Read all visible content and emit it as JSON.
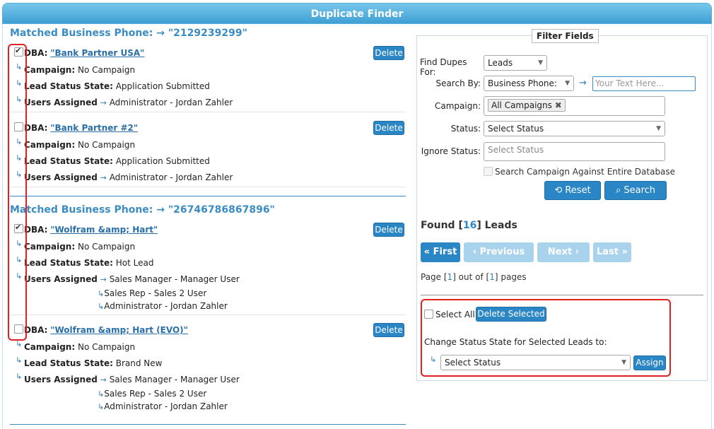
{
  "window": {
    "title": "Duplicate Finder"
  },
  "groups": [
    {
      "heading_label": "Matched Business Phone: → ",
      "heading_value": "\"2129239299\"",
      "records": [
        {
          "checked": true,
          "dba_label": "DBA:",
          "dba_value": "\"Bank Partner USA\"",
          "campaign_label": "Campaign:",
          "campaign_value": "No Campaign",
          "status_label": "Lead Status State:",
          "status_value": "Application Submitted",
          "users_label": "Users Assigned",
          "users": [
            "Administrator - Jordan Zahler"
          ],
          "delete_label": "Delete"
        },
        {
          "checked": false,
          "dba_label": "DBA:",
          "dba_value": "\"Bank Partner #2\"",
          "campaign_label": "Campaign:",
          "campaign_value": "No Campaign",
          "status_label": "Lead Status State:",
          "status_value": "Application Submitted",
          "users_label": "Users Assigned",
          "users": [
            "Administrator - Jordan Zahler"
          ],
          "delete_label": "Delete"
        }
      ]
    },
    {
      "heading_label": "Matched Business Phone: → ",
      "heading_value": "\"26746786867896\"",
      "records": [
        {
          "checked": true,
          "dba_label": "DBA:",
          "dba_value": "\"Wolfram &amp; Hart\"",
          "campaign_label": "Campaign:",
          "campaign_value": "No Campaign",
          "status_label": "Lead Status State:",
          "status_value": "Hot Lead",
          "users_label": "Users Assigned",
          "users": [
            "Sales Manager - Manager User",
            "Sales Rep - Sales 2 User",
            "Administrator - Jordan Zahler"
          ],
          "delete_label": "Delete"
        },
        {
          "checked": false,
          "dba_label": "DBA:",
          "dba_value": "\"Wolfram &amp; Hart (EVO)\"",
          "campaign_label": "Campaign:",
          "campaign_value": "No Campaign",
          "status_label": "Lead Status State:",
          "status_value": "Brand New",
          "users_label": "Users Assigned",
          "users": [
            "Sales Manager - Manager User",
            "Sales Rep - Sales 2 User",
            "Administrator - Jordan Zahler"
          ],
          "delete_label": "Delete"
        }
      ]
    }
  ],
  "filter": {
    "legend": "Filter Fields",
    "find_dupes_label": "Find Dupes For:",
    "find_dupes_value": "Leads",
    "search_by_label": "Search By:",
    "search_by_value": "Business Phone:",
    "search_placeholder": "Your Text Here...",
    "campaign_label": "Campaign:",
    "campaign_chip": "All Campaigns",
    "status_label": "Status:",
    "status_value": "Select Status",
    "ignore_status_label": "Ignore Status:",
    "ignore_status_placeholder": "Select Status",
    "search_entire_label": "Search Campaign Against Entire Database",
    "reset_label": "Reset",
    "search_label": "Search"
  },
  "results": {
    "found_prefix": "Found [",
    "found_count": "16",
    "found_suffix": "] Leads",
    "first_label": "First",
    "previous_label": "Previous",
    "next_label": "Next",
    "last_label": "Last",
    "page_text_a": "Page [",
    "page_current": "1",
    "page_text_b": "] out of [",
    "page_total": "1",
    "page_text_c": "] pages"
  },
  "bulk": {
    "select_all_label": "Select All",
    "delete_selected_label": "Delete Selected",
    "change_status_label": "Change Status State for Selected Leads to:",
    "status_select_value": "Select Status",
    "assign_label": "Assign"
  },
  "colors": {
    "accent": "#2a86c4",
    "heading": "#3a8cc2",
    "highlight": "#e02020"
  }
}
